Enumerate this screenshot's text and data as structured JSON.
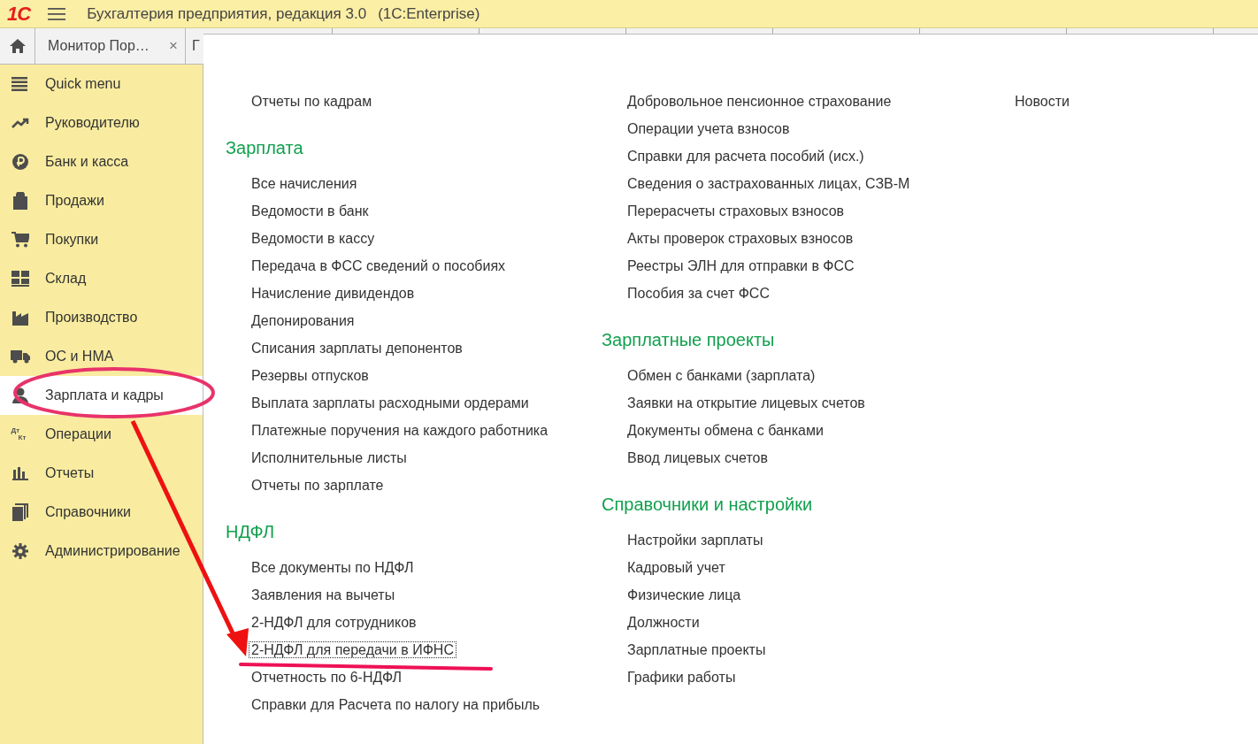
{
  "app": {
    "logo": "1С",
    "title": "Бухгалтерия предприятия, редакция 3.0",
    "platform": "(1С:Enterprise)"
  },
  "tabs": [
    {
      "kind": "home"
    },
    {
      "kind": "doc",
      "label": "Монитор Пор…",
      "close": "×"
    },
    {
      "kind": "doc",
      "label": "Г"
    }
  ],
  "sidebar": {
    "items": [
      {
        "label": "Quick menu",
        "selected": false
      },
      {
        "label": "Руководителю",
        "selected": false
      },
      {
        "label": "Банк и касса",
        "selected": false
      },
      {
        "label": "Продажи",
        "selected": false
      },
      {
        "label": "Покупки",
        "selected": false
      },
      {
        "label": "Склад",
        "selected": false
      },
      {
        "label": "Производство",
        "selected": false
      },
      {
        "label": "ОС и НМА",
        "selected": false
      },
      {
        "label": "Зарплата и кадры",
        "selected": true
      },
      {
        "label": "Операции",
        "selected": false,
        "icon_text": [
          "Дт",
          "Кт"
        ]
      },
      {
        "label": "Отчеты",
        "selected": false
      },
      {
        "label": "Справочники",
        "selected": false
      },
      {
        "label": "Администрирование",
        "selected": false
      }
    ]
  },
  "columns": [
    {
      "groups": [
        {
          "items": [
            {
              "label": "Отчеты по кадрам",
              "focused": false
            }
          ]
        },
        {
          "heading": "Зарплата",
          "items": [
            {
              "label": "Все начисления",
              "focused": false
            },
            {
              "label": "Ведомости в банк",
              "focused": false
            },
            {
              "label": "Ведомости в кассу",
              "focused": false
            },
            {
              "label": "Передача в ФСС сведений о пособиях",
              "focused": false
            },
            {
              "label": "Начисление дивидендов",
              "focused": false
            },
            {
              "label": "Депонирования",
              "focused": false
            },
            {
              "label": "Списания зарплаты депонентов",
              "focused": false
            },
            {
              "label": "Резервы отпусков",
              "focused": false
            },
            {
              "label": "Выплата зарплаты расходными ордерами",
              "focused": false
            },
            {
              "label": "Платежные поручения на каждого работника",
              "focused": false
            },
            {
              "label": "Исполнительные листы",
              "focused": false
            },
            {
              "label": "Отчеты по зарплате",
              "focused": false
            }
          ]
        },
        {
          "heading": "НДФЛ",
          "items": [
            {
              "label": "Все документы по НДФЛ",
              "focused": false
            },
            {
              "label": "Заявления на вычеты",
              "focused": false
            },
            {
              "label": "2-НДФЛ для сотрудников",
              "focused": false
            },
            {
              "label": "2-НДФЛ для передачи в ИФНС",
              "focused": true
            },
            {
              "label": "Отчетность по 6-НДФЛ",
              "focused": false
            },
            {
              "label": "Справки для Расчета по налогу на прибыль",
              "focused": false
            }
          ]
        }
      ]
    },
    {
      "groups": [
        {
          "items": [
            {
              "label": "Добровольное пенсионное страхование",
              "focused": false
            },
            {
              "label": "Операции учета взносов",
              "focused": false
            },
            {
              "label": "Справки для расчета пособий (исх.)",
              "focused": false
            },
            {
              "label": "Сведения о застрахованных лицах, СЗВ-М",
              "focused": false
            },
            {
              "label": "Перерасчеты страховых взносов",
              "focused": false
            },
            {
              "label": "Акты проверок страховых взносов",
              "focused": false
            },
            {
              "label": "Реестры ЭЛН для отправки в ФСС",
              "focused": false
            },
            {
              "label": "Пособия за счет ФСС",
              "focused": false
            }
          ]
        },
        {
          "heading": "Зарплатные проекты",
          "items": [
            {
              "label": "Обмен с банками (зарплата)",
              "focused": false
            },
            {
              "label": "Заявки на открытие лицевых счетов",
              "focused": false
            },
            {
              "label": "Документы обмена с банками",
              "focused": false
            },
            {
              "label": "Ввод лицевых счетов",
              "focused": false
            }
          ]
        },
        {
          "heading": "Справочники и настройки",
          "items": [
            {
              "label": "Настройки зарплаты",
              "focused": false
            },
            {
              "label": "Кадровый учет",
              "focused": false
            },
            {
              "label": "Физические лица",
              "focused": false
            },
            {
              "label": "Должности",
              "focused": false
            },
            {
              "label": "Зарплатные проекты",
              "focused": false
            },
            {
              "label": "Графики работы",
              "focused": false
            }
          ]
        }
      ]
    },
    {
      "groups": [
        {
          "items": [
            {
              "label": "Новости",
              "focused": false
            }
          ]
        }
      ]
    }
  ]
}
